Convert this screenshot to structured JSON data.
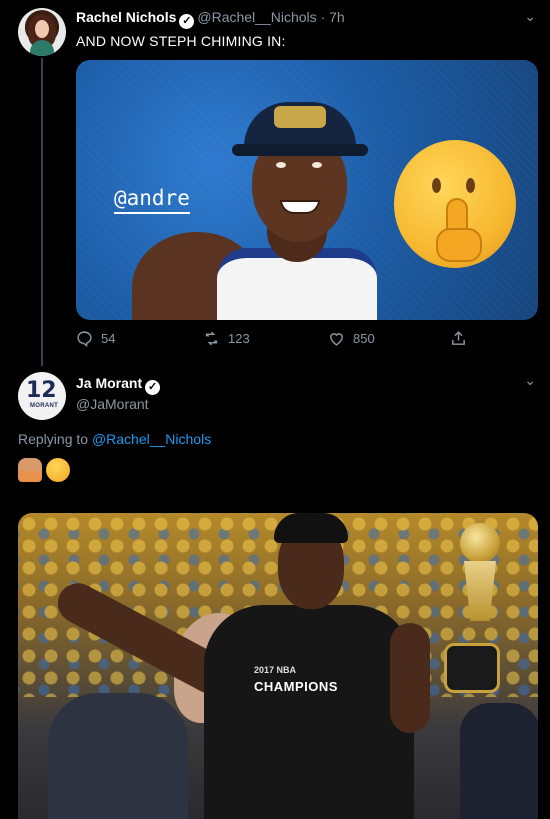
{
  "tweet1": {
    "author_name": "Rachel Nichols",
    "author_handle": "@Rachel__Nichols",
    "time": "· 7h",
    "text": "AND NOW STEPH CHIMING IN:",
    "media_caption": "@andre",
    "replies": "54",
    "retweets": "123",
    "likes": "850",
    "icons": [
      "reply-icon",
      "retweet-icon",
      "like-icon",
      "share-icon"
    ]
  },
  "tweet2": {
    "author_name": "Ja Morant",
    "author_handle": "@JaMorant",
    "avatar_number": "12",
    "avatar_text": "MORANT",
    "reply_prefix": "Replying to",
    "reply_to": "@Rachel__Nichols",
    "media_text_small": "2017 NBA",
    "media_text": "CHAMPIONS"
  },
  "colors": {
    "background": "#000000",
    "link": "#1d9bf0",
    "muted": "#8b98a5"
  }
}
